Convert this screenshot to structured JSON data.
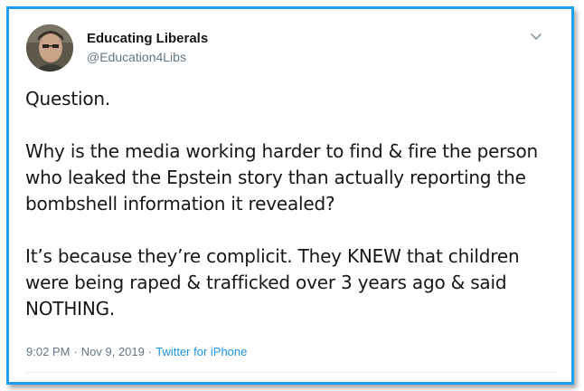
{
  "tweet": {
    "author_name": "Educating Liberals",
    "author_handle": "@Education4Libs",
    "paragraphs": [
      "Question.",
      "Why is the media working harder to find & fire the person who leaked the Epstein story than actually reporting the bombshell information it revealed?",
      "It’s because they’re complicit. They KNEW that children were being raped & trafficked over 3 years ago & said NOTHING."
    ],
    "time": "9:02 PM",
    "separator": "·",
    "date": "Nov 9, 2019",
    "source": "Twitter for iPhone"
  },
  "icons": {
    "avatar": "profile-photo",
    "menu": "chevron-down-icon"
  },
  "colors": {
    "border": "#1da1f2",
    "link": "#1b95e0",
    "text": "#14171a",
    "muted": "#657786"
  }
}
